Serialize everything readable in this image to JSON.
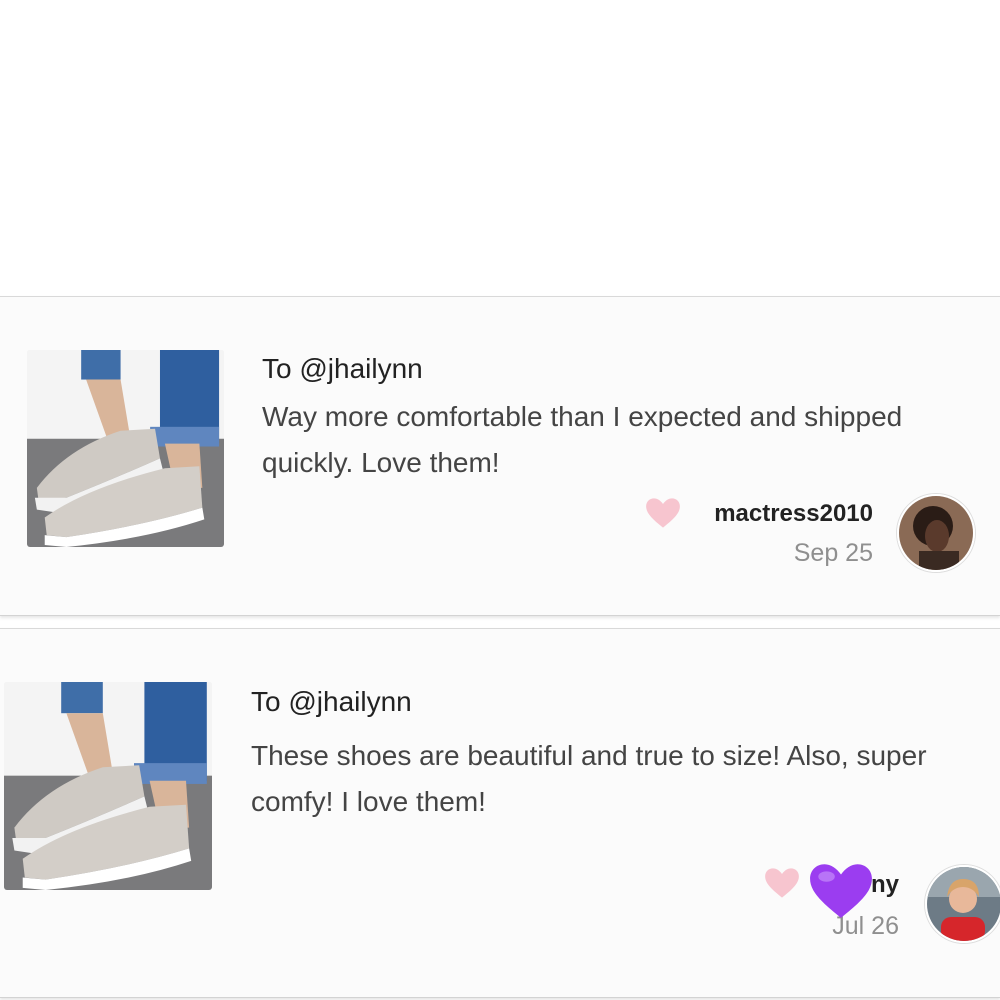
{
  "reviews": [
    {
      "to": "To @jhailynn",
      "text": "Way more comfortable than I expected and shipped quickly. Love them!",
      "username": "mactress2010",
      "date": "Sep 25",
      "like_icon": "heart-icon",
      "like_color": "#f7c5cf"
    },
    {
      "to": "To @jhailynn",
      "text": "These shoes are beautiful and true to size! Also, super comfy! I love them!",
      "username": "ny",
      "date": "Jul 26",
      "like_icon": "heart-icon",
      "like_color": "#f7c5cf",
      "overlay_icon": "purple-heart-emoji",
      "overlay_color": "#9b3df0"
    }
  ]
}
